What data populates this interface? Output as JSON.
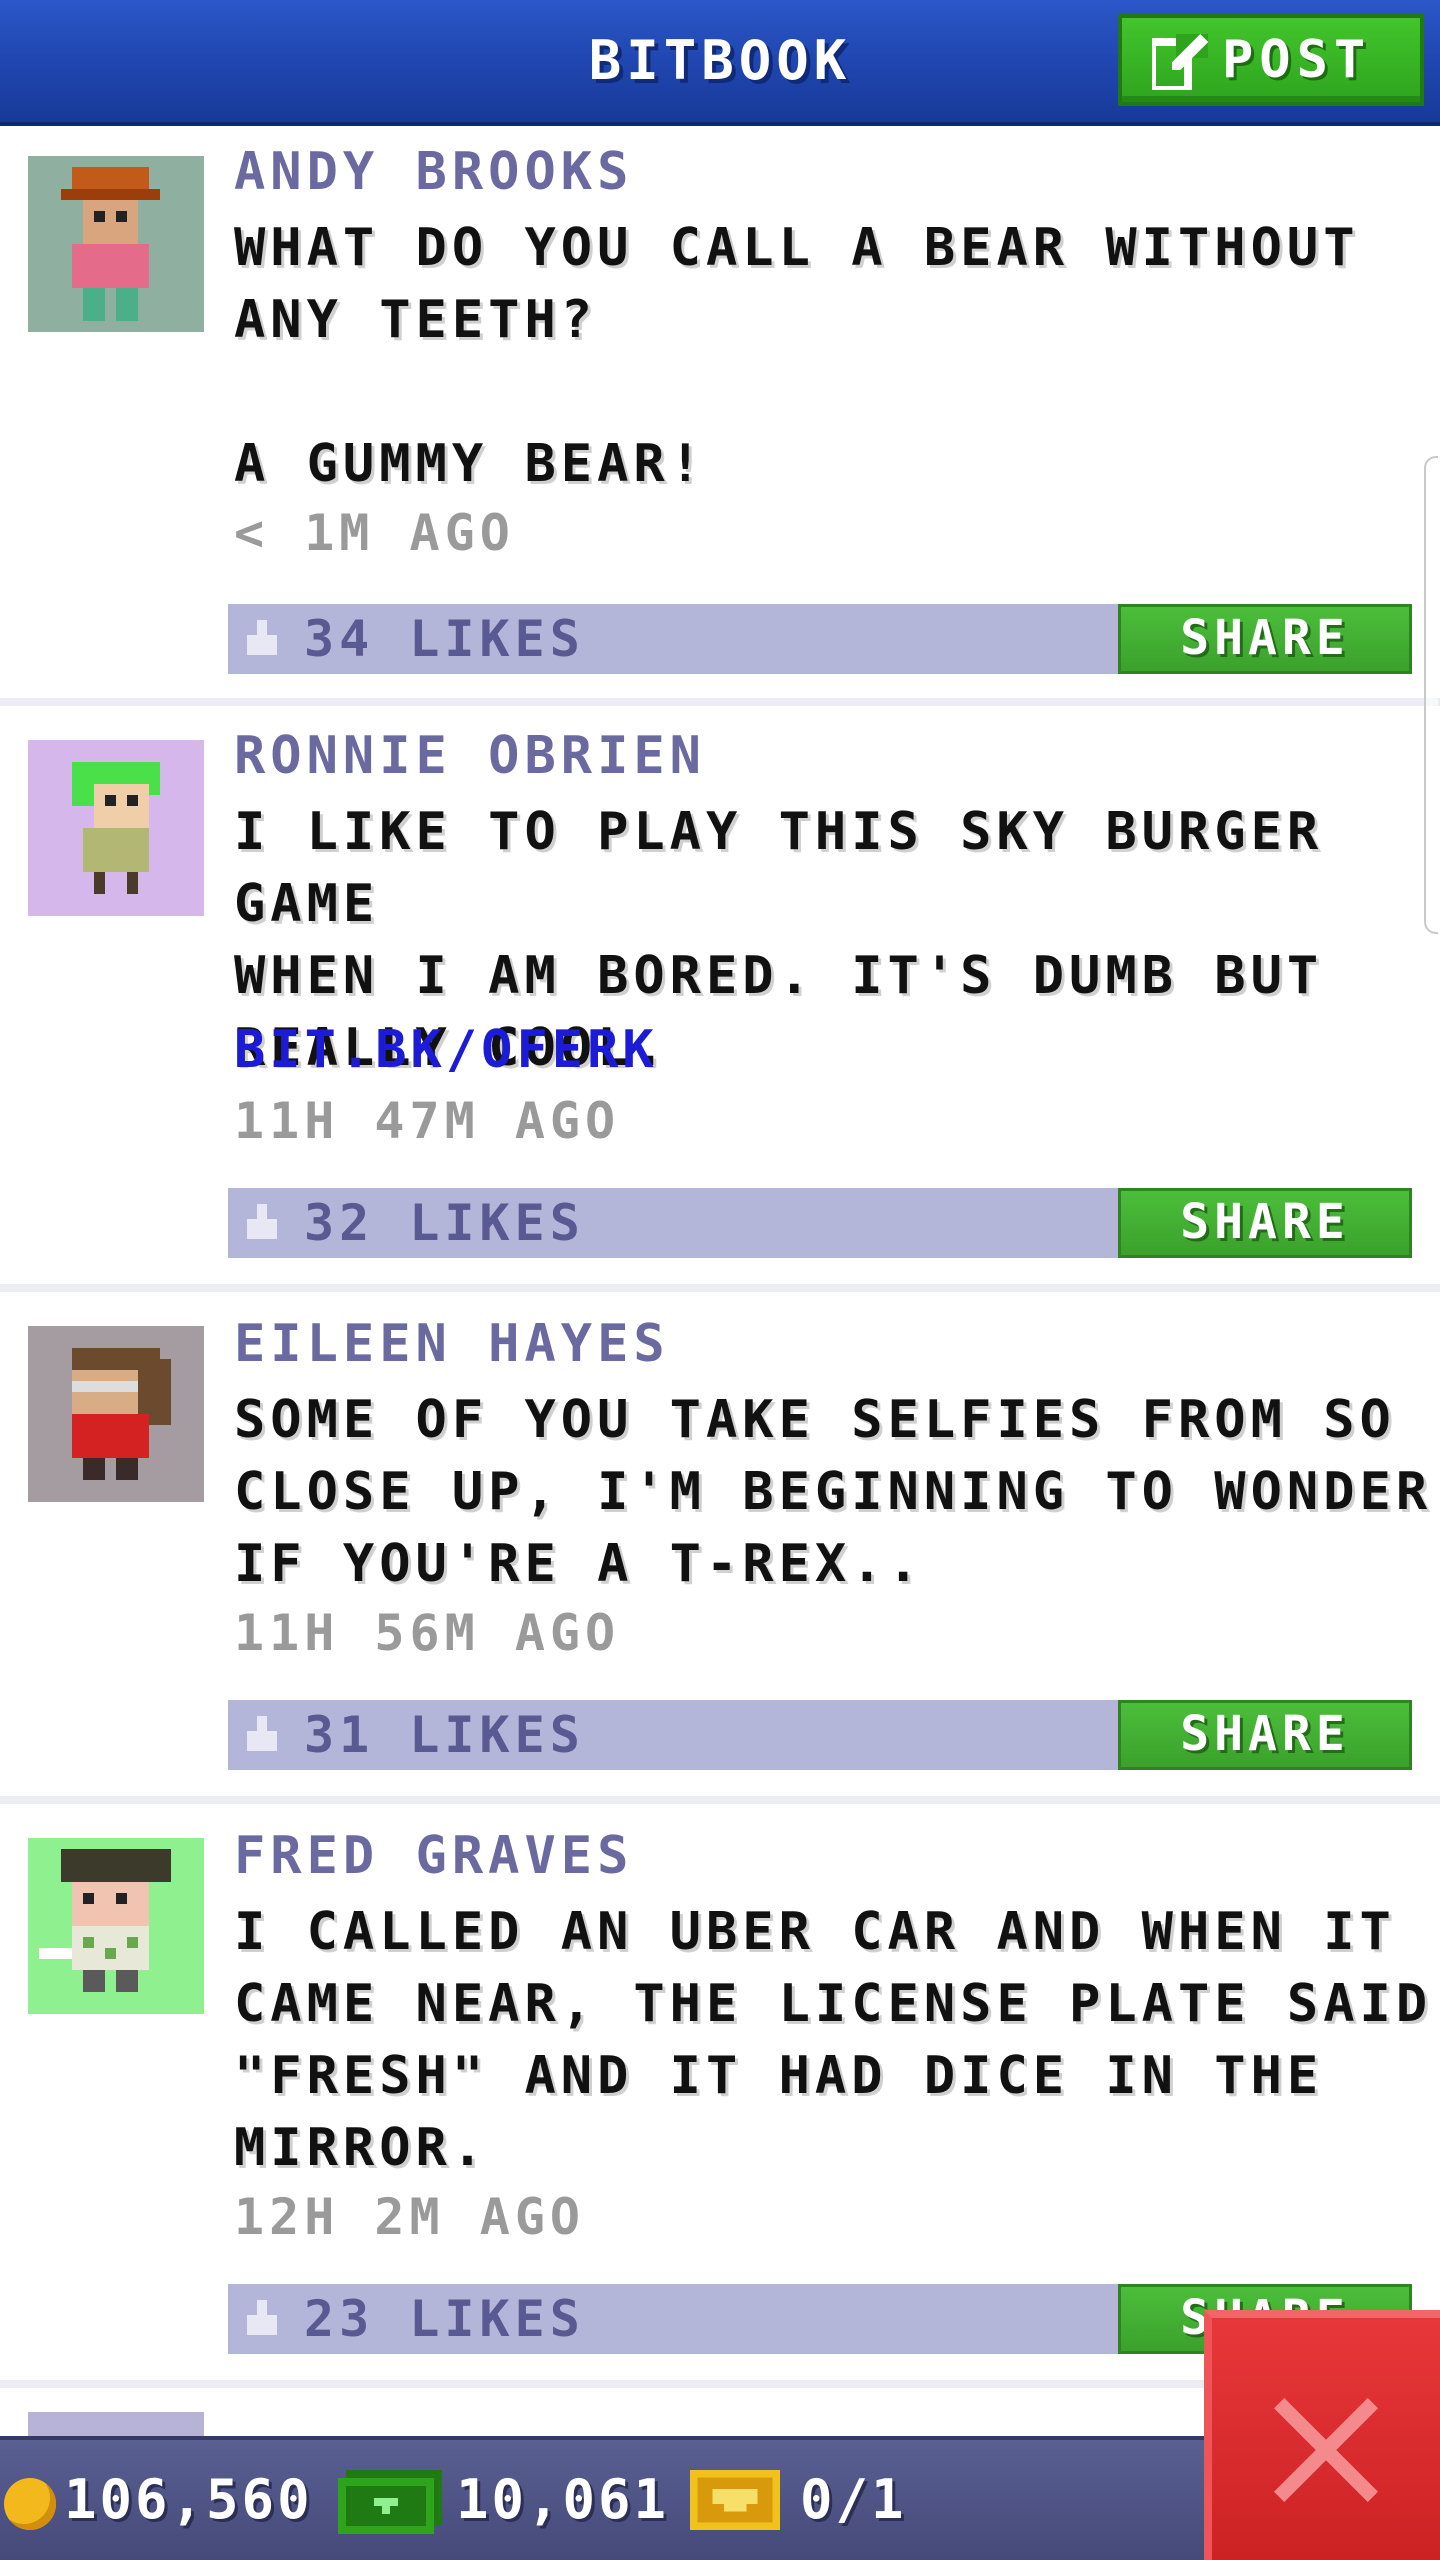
{
  "header": {
    "title": "BITBOOK",
    "post_label": "POST"
  },
  "posts": [
    {
      "author": "ANDY BROOKS",
      "text": "WHAT DO YOU CALL A BEAR WITHOUT\nANY TEETH?\n\nA GUMMY BEAR!",
      "link": "",
      "time": "< 1M AGO",
      "likes": "34 LIKES",
      "share_label": "SHARE",
      "avatar_bg": "#8fb0a0"
    },
    {
      "author": "RONNIE OBRIEN",
      "text": "I LIKE TO PLAY THIS SKY BURGER GAME\nWHEN I AM BORED. IT'S DUMB BUT\nREALLY COOL.",
      "link": "BIT.BK/OFERK",
      "time": "11H 47M AGO",
      "likes": "32 LIKES",
      "share_label": "SHARE",
      "avatar_bg": "#d6b7ec"
    },
    {
      "author": "EILEEN HAYES",
      "text": "SOME OF YOU TAKE SELFIES FROM SO\nCLOSE UP, I'M BEGINNING TO WONDER\nIF YOU'RE A T-REX..",
      "link": "",
      "time": "11H 56M AGO",
      "likes": "31 LIKES",
      "share_label": "SHARE",
      "avatar_bg": "#a49ca0"
    },
    {
      "author": "FRED GRAVES",
      "text": "I CALLED AN UBER CAR AND WHEN IT\nCAME NEAR, THE LICENSE PLATE SAID\n\"FRESH\" AND IT HAD DICE IN THE\nMIRROR.",
      "link": "",
      "time": "12H 2M AGO",
      "likes": "23 LIKES",
      "share_label": "SHARE",
      "avatar_bg": "#8ef08e"
    }
  ],
  "status_bar": {
    "coins": "106,560",
    "bux": "10,061",
    "tickets": "0/1"
  },
  "icons": {
    "post": "edit-icon",
    "like": "thumbs-up-icon",
    "coin": "coin-icon",
    "bux": "cash-icon",
    "tickets": "ticket-icon",
    "close": "close-icon"
  },
  "colors": {
    "header": "#1f45ae",
    "green_button": "#3ba12c",
    "likes_bar": "#b3b6d8",
    "name": "#6a6aa0",
    "link": "#1c1cd6",
    "close_button": "#cc2224"
  }
}
